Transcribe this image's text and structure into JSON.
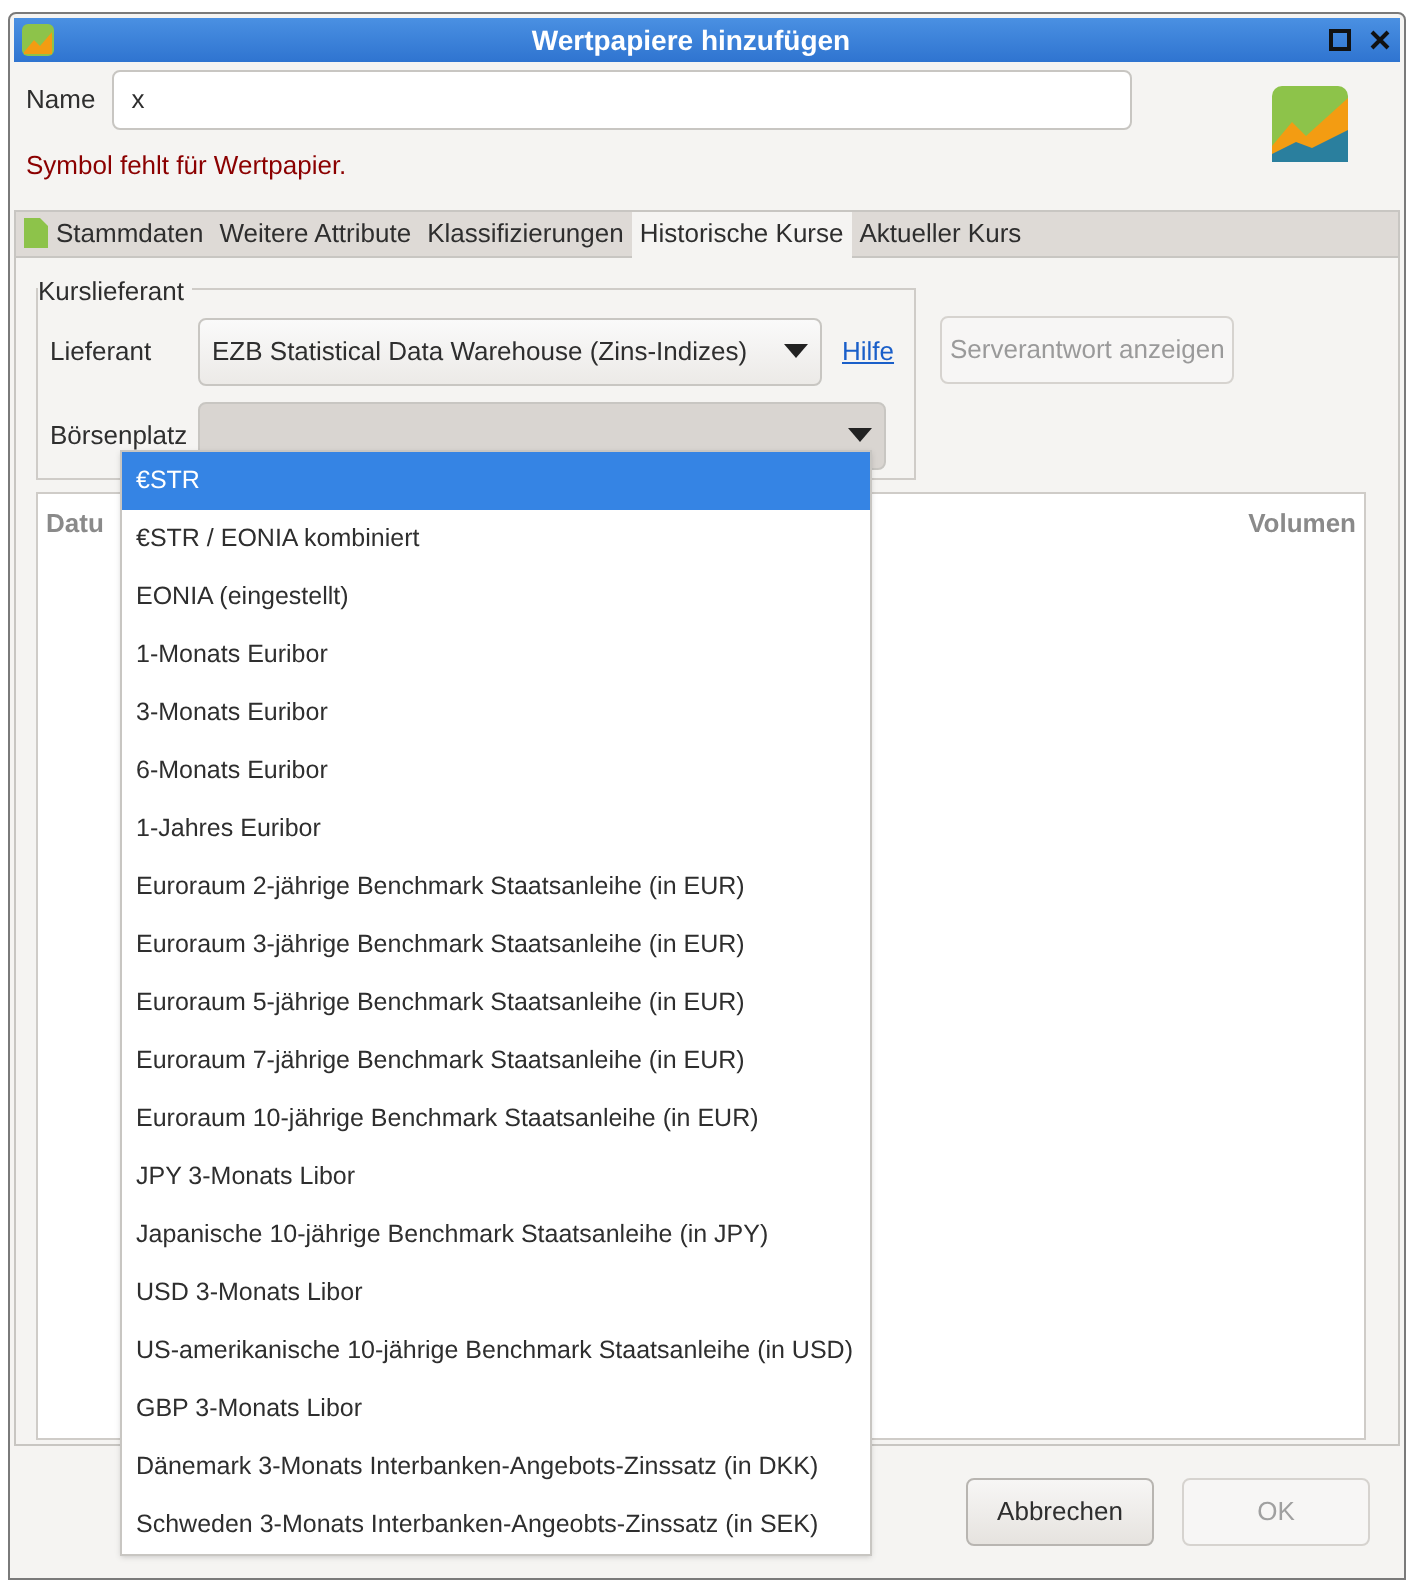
{
  "window": {
    "title": "Wertpapiere hinzufügen"
  },
  "name_field": {
    "label": "Name",
    "value": "x"
  },
  "error": "Symbol fehlt für Wertpapier.",
  "tabs": [
    {
      "label": "Stammdaten",
      "selected": false,
      "icon": true
    },
    {
      "label": "Weitere Attribute",
      "selected": false
    },
    {
      "label": "Klassifizierungen",
      "selected": false
    },
    {
      "label": "Historische Kurse",
      "selected": true
    },
    {
      "label": "Aktueller Kurs",
      "selected": false
    }
  ],
  "provider_group": {
    "title": "Kurslieferant",
    "provider_label": "Lieferant",
    "provider_value": "EZB Statistical Data Warehouse (Zins-Indizes)",
    "help_link": "Hilfe",
    "exchange_label": "Börsenplatz"
  },
  "server_button": {
    "label": "Serverantwort anzeigen",
    "disabled": true
  },
  "table": {
    "columns": [
      "Datu",
      "Volumen"
    ]
  },
  "dropdown": [
    {
      "label": "€STR",
      "selected": true
    },
    {
      "label": "€STR / EONIA kombiniert",
      "selected": false
    },
    {
      "label": "EONIA (eingestellt)",
      "selected": false
    },
    {
      "label": "1-Monats Euribor",
      "selected": false
    },
    {
      "label": "3-Monats Euribor",
      "selected": false
    },
    {
      "label": "6-Monats Euribor",
      "selected": false
    },
    {
      "label": "1-Jahres Euribor",
      "selected": false
    },
    {
      "label": "Euroraum 2-jährige Benchmark Staatsanleihe (in EUR)",
      "selected": false
    },
    {
      "label": "Euroraum 3-jährige Benchmark Staatsanleihe (in EUR)",
      "selected": false
    },
    {
      "label": "Euroraum 5-jährige Benchmark Staatsanleihe (in EUR)",
      "selected": false
    },
    {
      "label": "Euroraum 7-jährige Benchmark Staatsanleihe (in EUR)",
      "selected": false
    },
    {
      "label": "Euroraum 10-jährige Benchmark Staatsanleihe (in EUR)",
      "selected": false
    },
    {
      "label": "JPY 3-Monats Libor",
      "selected": false
    },
    {
      "label": "Japanische 10-jährige Benchmark Staatsanleihe (in JPY)",
      "selected": false
    },
    {
      "label": "USD 3-Monats Libor",
      "selected": false
    },
    {
      "label": "US-amerikanische 10-jährige Benchmark Staatsanleihe (in USD)",
      "selected": false
    },
    {
      "label": "GBP 3-Monats Libor",
      "selected": false
    },
    {
      "label": "Dänemark 3-Monats Interbanken-Angebots-Zinssatz (in DKK)",
      "selected": false
    },
    {
      "label": "Schweden 3-Monats Interbanken-Angeobts-Zinssatz (in SEK)",
      "selected": false
    }
  ],
  "buttons": [
    {
      "label": "Abbrechen",
      "disabled": false
    },
    {
      "label": "OK",
      "disabled": true
    }
  ]
}
